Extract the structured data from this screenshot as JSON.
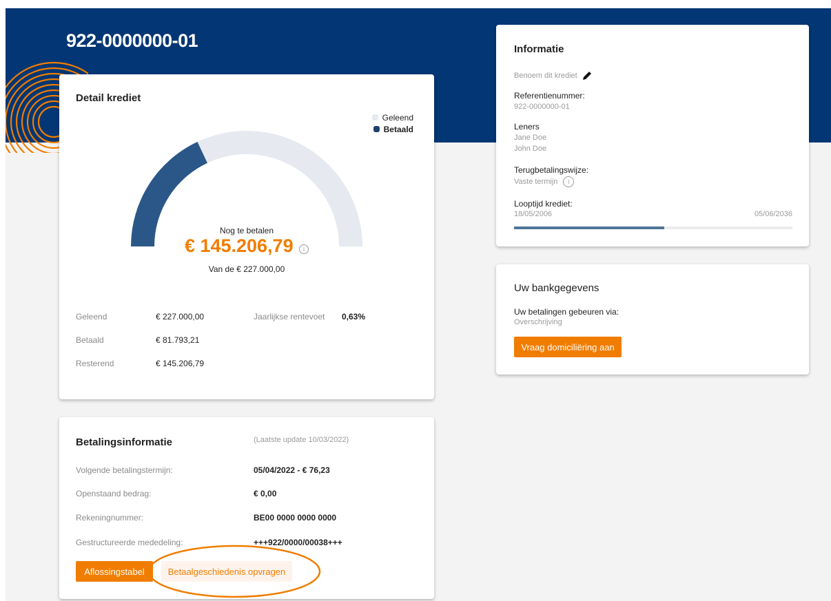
{
  "account_number": "922-0000000-01",
  "colors": {
    "brand_blue": "#033674",
    "accent_orange": "#f07d00",
    "paid_blue": "#2b5788",
    "borrowed_grey": "#e6eaf0"
  },
  "detail": {
    "title": "Detail krediet",
    "legend": {
      "borrowed": "Geleend",
      "paid": "Betaald"
    },
    "gauge": {
      "caption": "Nog te betalen",
      "remaining": "€ 145.206,79",
      "total_text": "Van de € 227.000,00",
      "paid_fraction": 0.36,
      "info_icon": "info-icon"
    },
    "stats": {
      "borrowed_label": "Geleend",
      "borrowed_value": "€ 227.000,00",
      "paid_label": "Betaald",
      "paid_value": "€ 81.793,21",
      "remaining_label": "Resterend",
      "remaining_value": "€ 145.206,79",
      "rate_label": "Jaarlijkse rentevoet",
      "rate_value": "0,63%"
    }
  },
  "payment": {
    "title": "Betalingsinformatie",
    "update": "(Laatste update 10/03/2022)",
    "rows": [
      {
        "label": "Volgende betalingstermijn:",
        "value": "05/04/2022 - € 76,23"
      },
      {
        "label": "Openstaand bedrag:",
        "value": "€ 0,00"
      },
      {
        "label": "Rekeningnummer:",
        "value": "BE00 0000 0000 0000"
      },
      {
        "label": "Gestructureerde mededeling:",
        "value": "+++922/0000/00038+++"
      }
    ],
    "btn_schedule": "Aflossingstabel",
    "btn_history": "Betaalgeschiedenis opvragen"
  },
  "info": {
    "title": "Informatie",
    "name_placeholder": "Benoem dit krediet",
    "edit_icon": "pencil-icon",
    "ref_label": "Referentienummer:",
    "ref_value": "922-0000000-01",
    "borrowers_label": "Leners",
    "borrowers": [
      "Jane Doe",
      "John Doe"
    ],
    "repayment_label": "Terugbetalingswijze:",
    "repayment_value": "Vaste termijn",
    "term_label": "Looptijd krediet:",
    "term_start": "18/05/2006",
    "term_end": "05/06/2036",
    "term_progress": 0.54
  },
  "bank": {
    "title": "Uw bankgegevens",
    "via_label": "Uw betalingen gebeuren via:",
    "via_value": "Overschrijving",
    "btn_domicile": "Vraag domiciliëring aan"
  }
}
